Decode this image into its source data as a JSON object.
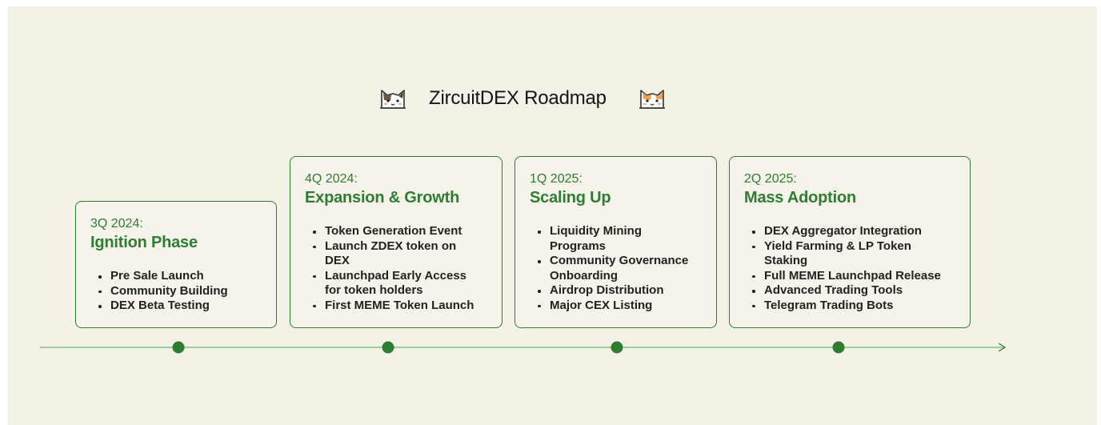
{
  "title": "ZircuitDEX Roadmap",
  "icons": {
    "left": "cat-face-icon",
    "right": "cat-face-icon"
  },
  "colors": {
    "accent": "#2e7d32",
    "line": "#7cc47c",
    "background": "#f4f1e7"
  },
  "phases": [
    {
      "quarter": "3Q 2024:",
      "name": "Ignition Phase",
      "items": [
        "Pre Sale Launch",
        "Community Building",
        "DEX Beta Testing"
      ]
    },
    {
      "quarter": "4Q 2024:",
      "name": "Expansion & Growth",
      "items": [
        "Token Generation Event",
        "Launch ZDEX token on DEX",
        "Launchpad Early Access for token holders",
        "First MEME Token Launch"
      ]
    },
    {
      "quarter": "1Q 2025:",
      "name": "Scaling Up",
      "items": [
        "Liquidity Mining Programs",
        "Community Governance Onboarding",
        "Airdrop Distribution",
        "Major CEX Listing"
      ]
    },
    {
      "quarter": "2Q 2025:",
      "name": "Mass Adoption",
      "items": [
        "DEX Aggregator Integration",
        "Yield Farming & LP Token Staking",
        "Full MEME Launchpad Release",
        "Advanced Trading Tools",
        "Telegram Trading Bots"
      ]
    }
  ]
}
